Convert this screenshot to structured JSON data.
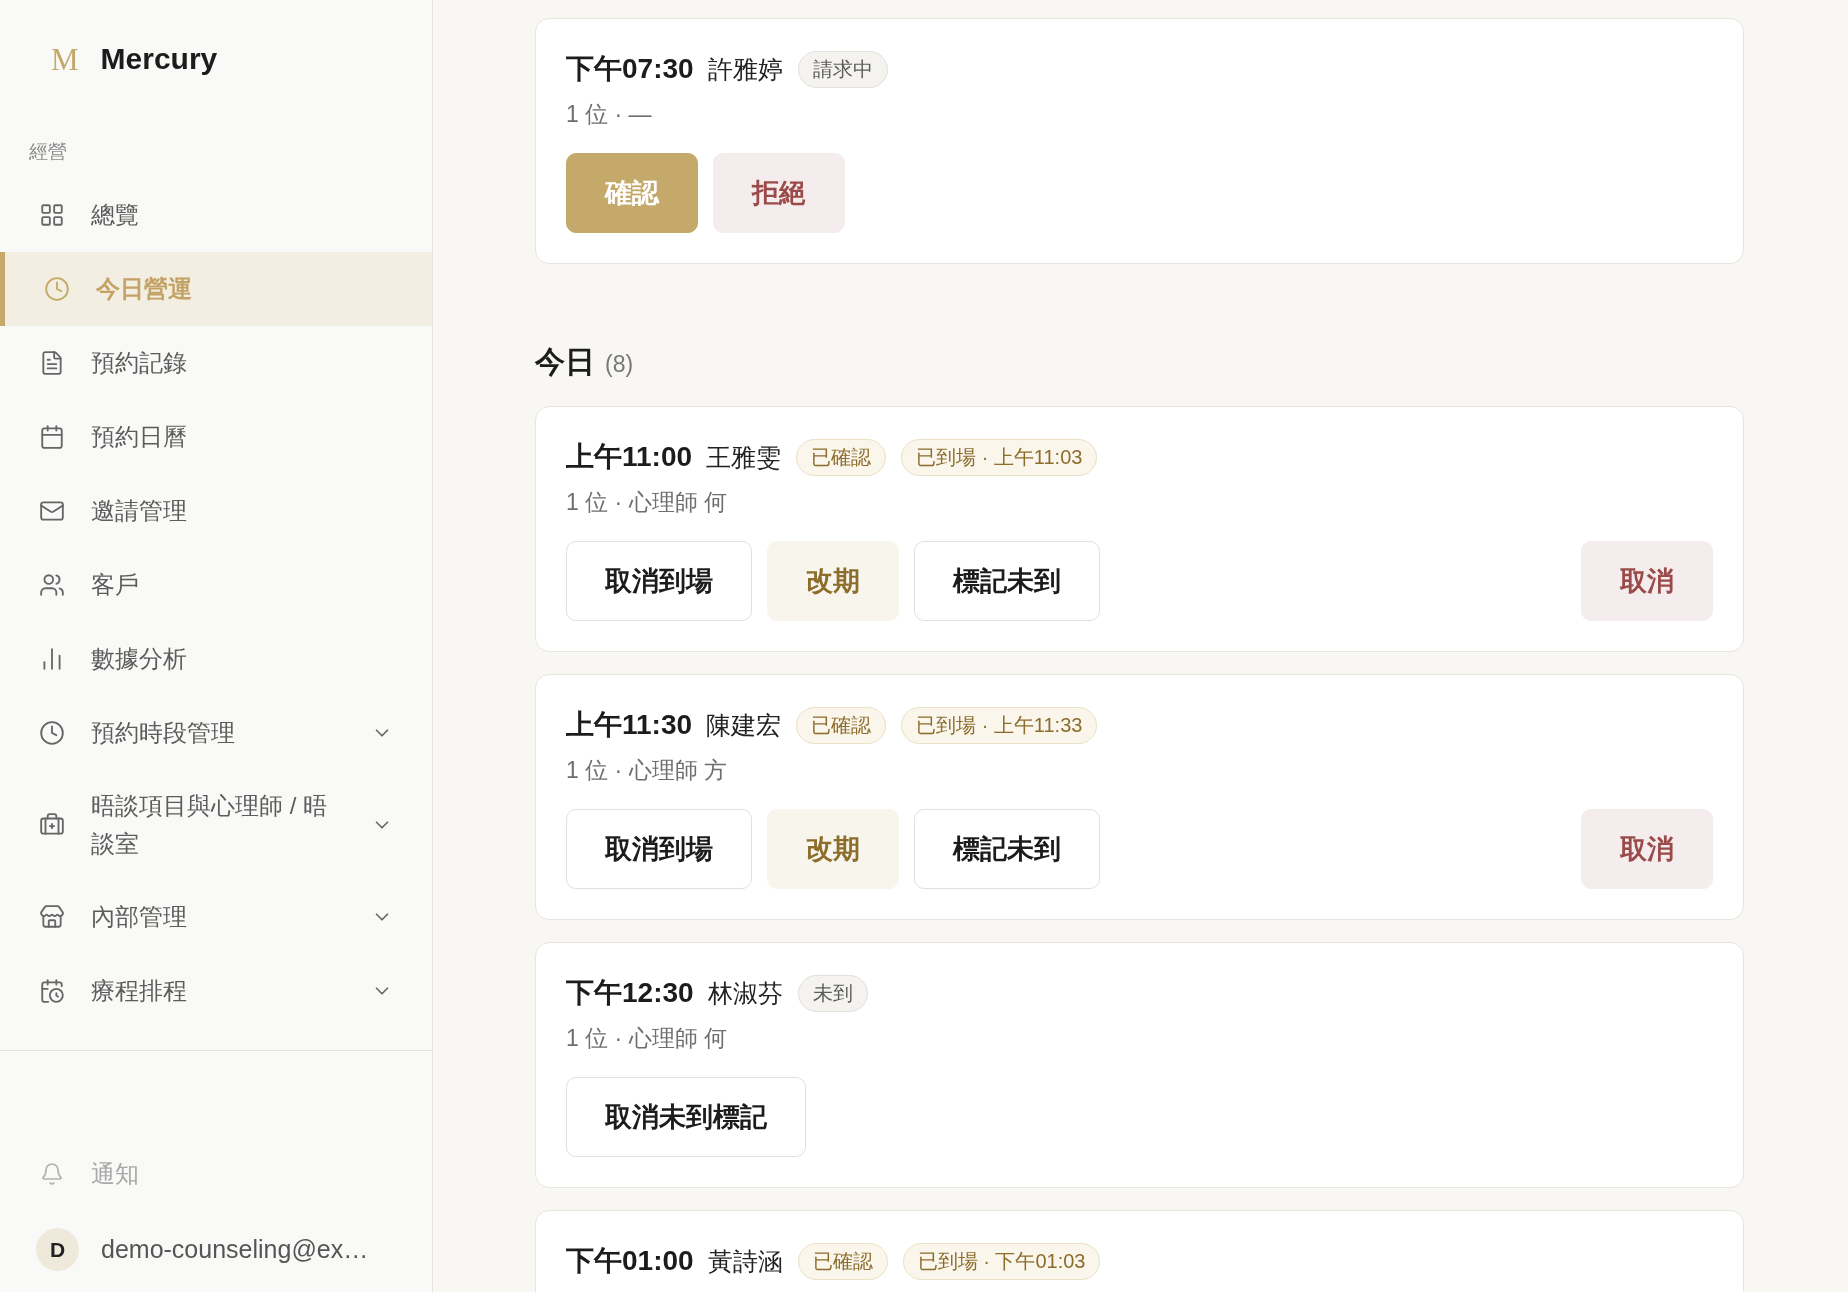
{
  "brand": {
    "logo": "M",
    "name": "Mercury"
  },
  "sidebar": {
    "section_label": "經營",
    "items": [
      {
        "label": "總覽",
        "kind": "link",
        "selected": false
      },
      {
        "label": "今日營運",
        "kind": "link",
        "selected": true
      },
      {
        "label": "預約記錄",
        "kind": "link",
        "selected": false
      },
      {
        "label": "預約日曆",
        "kind": "link",
        "selected": false
      },
      {
        "label": "邀請管理",
        "kind": "link",
        "selected": false
      },
      {
        "label": "客戶",
        "kind": "link",
        "selected": false
      },
      {
        "label": "數據分析",
        "kind": "link",
        "selected": false
      },
      {
        "label": "預約時段管理",
        "kind": "group",
        "selected": false,
        "expanded": false
      },
      {
        "label": "晤談項目與心理師 / 晤談室",
        "kind": "group",
        "selected": false,
        "expanded": false
      },
      {
        "label": "內部管理",
        "kind": "group",
        "selected": false,
        "expanded": false
      },
      {
        "label": "療程排程",
        "kind": "group",
        "selected": false,
        "expanded": false
      }
    ],
    "notifications": {
      "label": "通知"
    },
    "user": {
      "initial": "D",
      "email": "demo-counseling@ex…"
    }
  },
  "main": {
    "request_cards": [
      {
        "time": "下午07:30",
        "name": "許雅婷",
        "badges": [
          {
            "label": "請求中",
            "kind": "neutral"
          }
        ],
        "details": "1 位 · —",
        "actions": [
          {
            "label": "確認",
            "kind": "primary"
          },
          {
            "label": "拒絕",
            "kind": "danger"
          }
        ]
      }
    ],
    "today": {
      "title": "今日",
      "count": "(8)",
      "cards": [
        {
          "time": "上午11:00",
          "name": "王雅雯",
          "badges": [
            {
              "label": "已確認",
              "kind": "accent"
            },
            {
              "label": "已到場 · 上午11:03",
              "kind": "accent"
            }
          ],
          "details": "1 位 · 心理師 何",
          "actions": [
            {
              "label": "取消到場",
              "kind": "outline"
            },
            {
              "label": "改期",
              "kind": "soft"
            },
            {
              "label": "標記未到",
              "kind": "outline"
            }
          ],
          "trailing_actions": [
            {
              "label": "取消",
              "kind": "danger"
            }
          ]
        },
        {
          "time": "上午11:30",
          "name": "陳建宏",
          "badges": [
            {
              "label": "已確認",
              "kind": "accent"
            },
            {
              "label": "已到場 · 上午11:33",
              "kind": "accent"
            }
          ],
          "details": "1 位 · 心理師 方",
          "actions": [
            {
              "label": "取消到場",
              "kind": "outline"
            },
            {
              "label": "改期",
              "kind": "soft"
            },
            {
              "label": "標記未到",
              "kind": "outline"
            }
          ],
          "trailing_actions": [
            {
              "label": "取消",
              "kind": "danger"
            }
          ]
        },
        {
          "time": "下午12:30",
          "name": "林淑芬",
          "badges": [
            {
              "label": "未到",
              "kind": "neutral"
            }
          ],
          "details": "1 位 · 心理師 何",
          "actions": [
            {
              "label": "取消未到標記",
              "kind": "outline"
            }
          ]
        },
        {
          "time": "下午01:00",
          "name": "黃詩涵",
          "badges": [
            {
              "label": "已確認",
              "kind": "accent"
            },
            {
              "label": "已到場 · 下午01:03",
              "kind": "accent"
            }
          ]
        }
      ]
    }
  }
}
